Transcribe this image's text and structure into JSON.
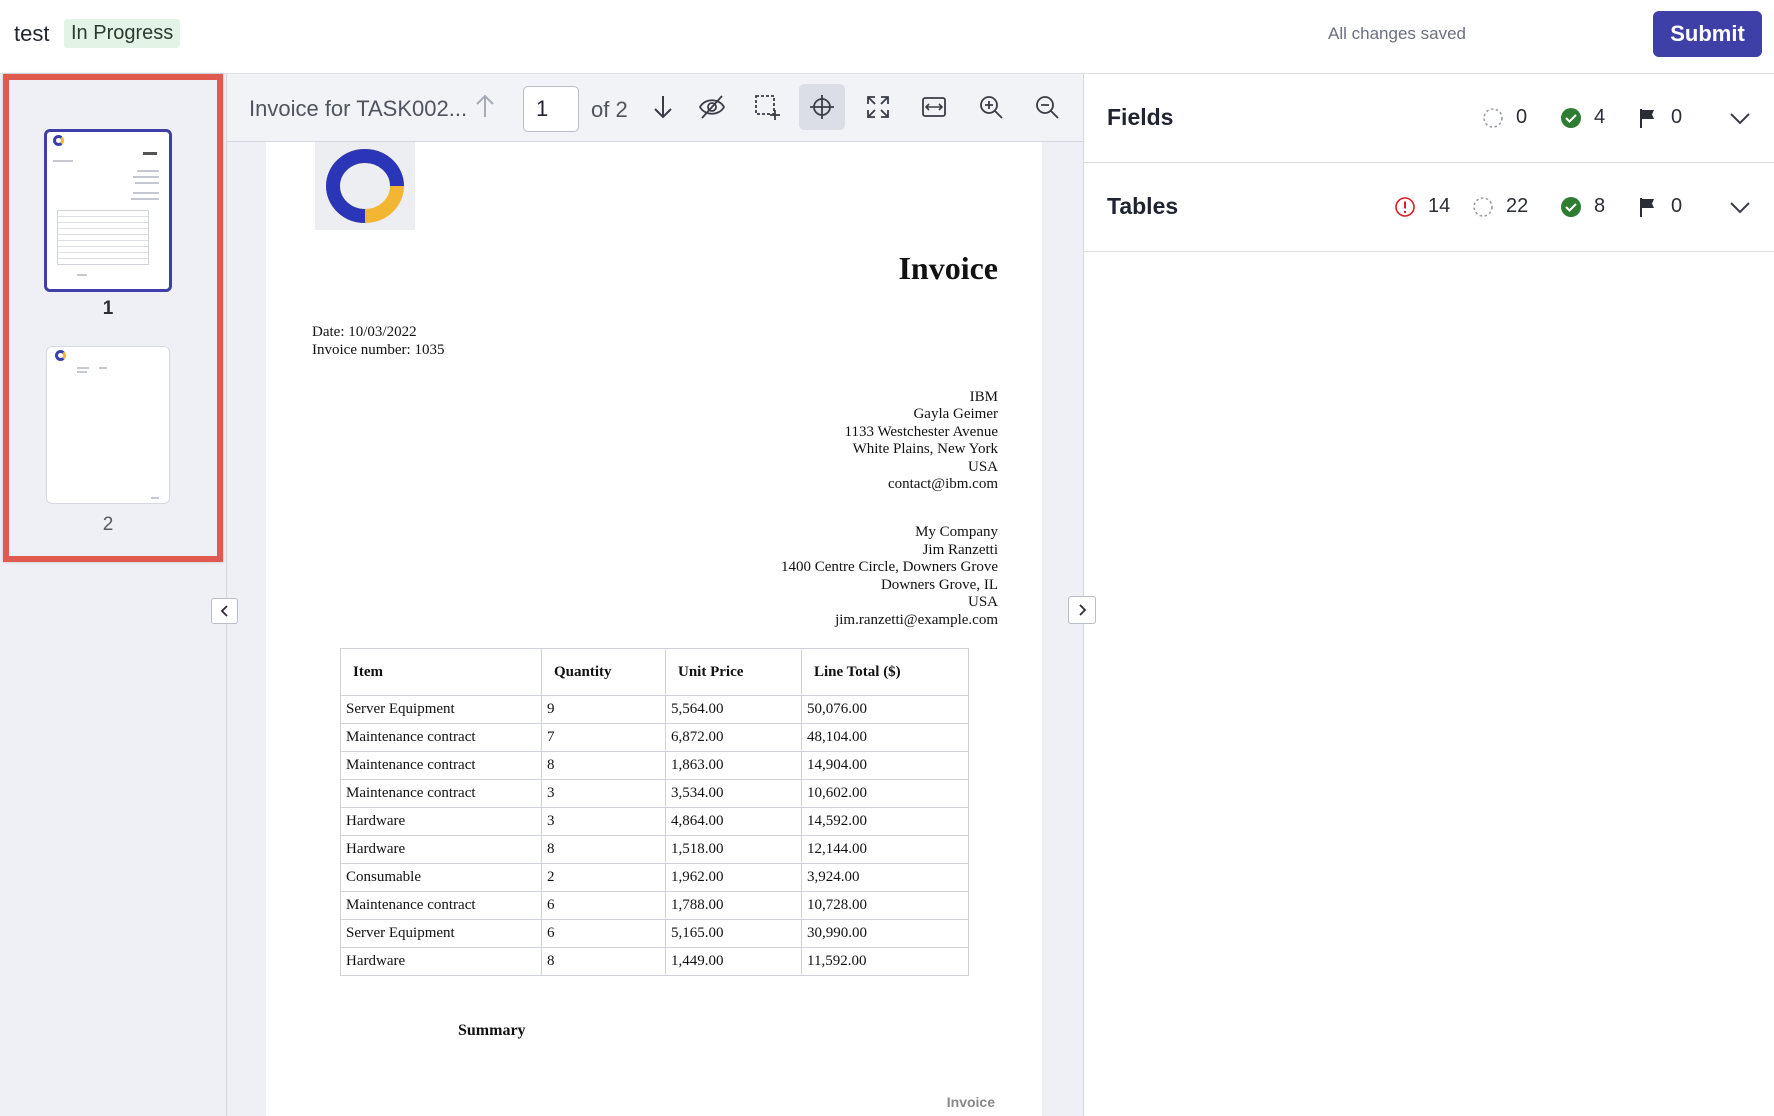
{
  "header": {
    "task_name": "test",
    "status": "In Progress",
    "save_status": "All changes saved",
    "submit_label": "Submit"
  },
  "thumbnails": [
    {
      "label": "1",
      "selected": true
    },
    {
      "label": "2",
      "selected": false
    }
  ],
  "toolbar": {
    "doc_title": "Invoice for TASK002...",
    "page_value": "1",
    "page_of": "of 2",
    "tools": [
      "arrow-down-icon",
      "eye-off-icon",
      "add-region-icon",
      "crosshair-icon",
      "fullscreen-icon",
      "fit-width-icon",
      "zoom-in-icon",
      "zoom-out-icon"
    ]
  },
  "document": {
    "title": "Invoice",
    "date": "Date: 10/03/2022",
    "invoice_number": "Invoice number: 1035",
    "bill_to": [
      "IBM",
      "Gayla Geimer",
      "1133 Westchester Avenue",
      "White Plains, New York",
      "USA",
      "contact@ibm.com"
    ],
    "from": [
      "My Company",
      "Jim Ranzetti",
      "1400 Centre Circle, Downers Grove",
      "Downers Grove, IL",
      "USA",
      "jim.ranzetti@example.com"
    ],
    "table": {
      "headers": [
        "Item",
        "Quantity",
        "Unit Price",
        "Line Total ($)"
      ],
      "rows": [
        [
          "Server Equipment",
          "9",
          "5,564.00",
          "50,076.00"
        ],
        [
          "Maintenance contract",
          "7",
          "6,872.00",
          "48,104.00"
        ],
        [
          "Maintenance contract",
          "8",
          "1,863.00",
          "14,904.00"
        ],
        [
          "Maintenance contract",
          "3",
          "3,534.00",
          "10,602.00"
        ],
        [
          "Hardware",
          "3",
          "4,864.00",
          "14,592.00"
        ],
        [
          "Hardware",
          "8",
          "1,518.00",
          "12,144.00"
        ],
        [
          "Consumable",
          "2",
          "1,962.00",
          "3,924.00"
        ],
        [
          "Maintenance contract",
          "6",
          "1,788.00",
          "10,728.00"
        ],
        [
          "Server Equipment",
          "6",
          "5,165.00",
          "30,990.00"
        ],
        [
          "Hardware",
          "8",
          "1,449.00",
          "11,592.00"
        ]
      ]
    },
    "summary": "Summary",
    "footer": "Invoice"
  },
  "panel": {
    "fields": {
      "title": "Fields",
      "pending": "0",
      "done": "4",
      "flagged": "0"
    },
    "tables": {
      "title": "Tables",
      "errors": "14",
      "pending": "22",
      "done": "8",
      "flagged": "0"
    }
  },
  "colors": {
    "accent": "#3f3fa8",
    "highlight": "#e05a4f",
    "success": "#2e7d32",
    "error": "#da1e28"
  }
}
